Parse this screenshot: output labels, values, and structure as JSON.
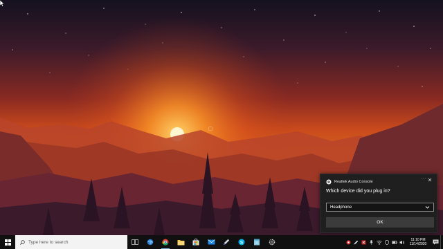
{
  "notification": {
    "app_name": "Realtek Audio Console",
    "more_label": "···",
    "close_label": "✕",
    "question": "Which device did you plug in?",
    "selected_device": "Headphone",
    "ok_label": "OK"
  },
  "taskbar": {
    "search_placeholder": "Type here to search",
    "pinned_icons": [
      "task-view-icon",
      "edge-icon",
      "chrome-icon",
      "file-explorer-icon",
      "store-icon",
      "mail-icon",
      "pen-icon",
      "skype-icon",
      "notes-icon",
      "settings-icon"
    ],
    "tray": {
      "time": "11:10 PM",
      "date": "11/14/2020"
    }
  },
  "colors": {
    "taskbar_bg": "#101010",
    "toast_bg": "#1f1f1f",
    "ok_button": "#3b3b3b",
    "accent": "#7fb0e6"
  }
}
